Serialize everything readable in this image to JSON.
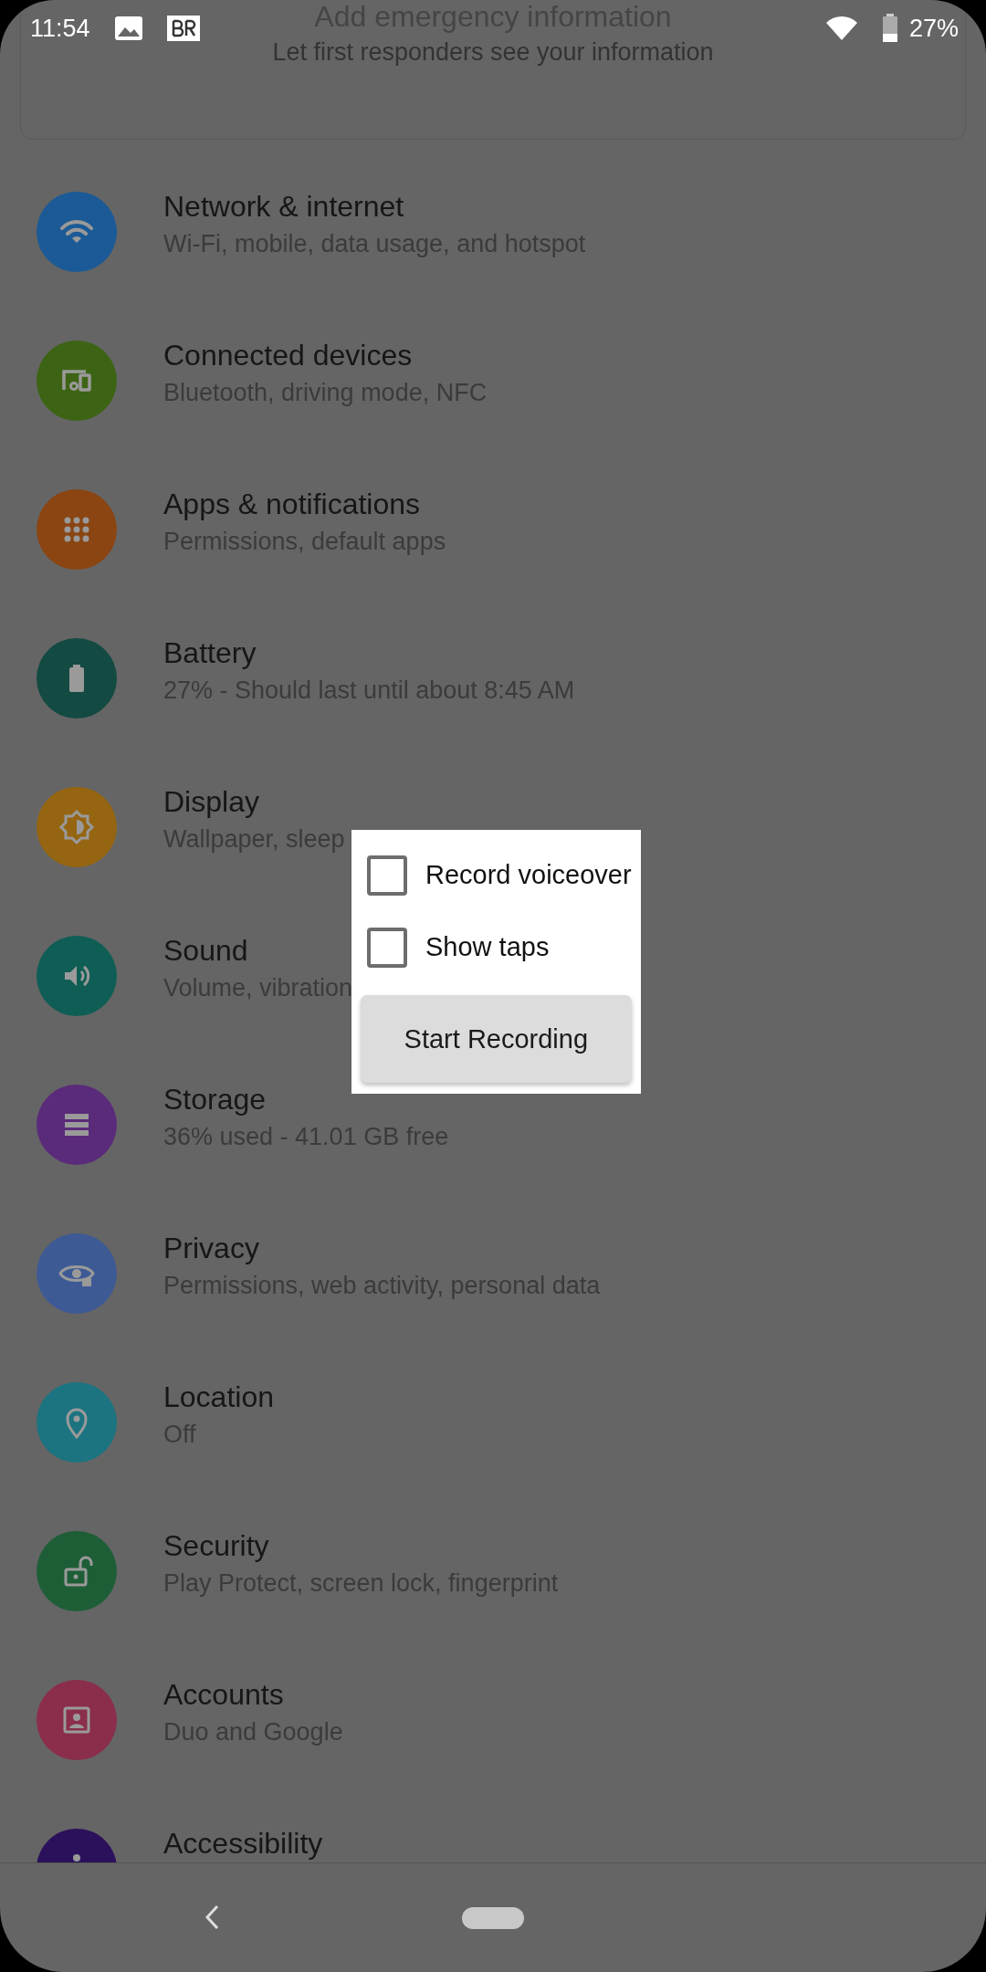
{
  "status_bar": {
    "time": "11:54",
    "battery": "27%"
  },
  "emergency_card": {
    "title": "Add emergency information",
    "subtitle": "Let first responders see your information"
  },
  "settings": [
    {
      "title": "Network & internet",
      "subtitle": "Wi-Fi, mobile, data usage, and hotspot",
      "color": "#1b5a96"
    },
    {
      "title": "Connected devices",
      "subtitle": "Bluetooth, driving mode, NFC",
      "color": "#3d6414"
    },
    {
      "title": "Apps & notifications",
      "subtitle": "Permissions, default apps",
      "color": "#8a4512"
    },
    {
      "title": "Battery",
      "subtitle": "27% - Should last until about 8:45 AM",
      "color": "#134a42"
    },
    {
      "title": "Display",
      "subtitle": "Wallpaper, sleep",
      "color": "#956512"
    },
    {
      "title": "Sound",
      "subtitle": "Volume, vibration",
      "color": "#0f5e56"
    },
    {
      "title": "Storage",
      "subtitle": "36% used - 41.01 GB free",
      "color": "#5b2b7b"
    },
    {
      "title": "Privacy",
      "subtitle": "Permissions, web activity, personal data",
      "color": "#3e5a95"
    },
    {
      "title": "Location",
      "subtitle": "Off",
      "color": "#1b7480"
    },
    {
      "title": "Security",
      "subtitle": "Play Protect, screen lock, fingerprint",
      "color": "#1e5e37"
    },
    {
      "title": "Accounts",
      "subtitle": "Duo and Google",
      "color": "#8b2e4b"
    },
    {
      "title": "Accessibility",
      "color": "#2b105b"
    }
  ],
  "dialog": {
    "options": [
      {
        "label": "Record voiceover",
        "checked": false
      },
      {
        "label": "Show taps",
        "checked": false
      }
    ],
    "button": "Start Recording"
  }
}
